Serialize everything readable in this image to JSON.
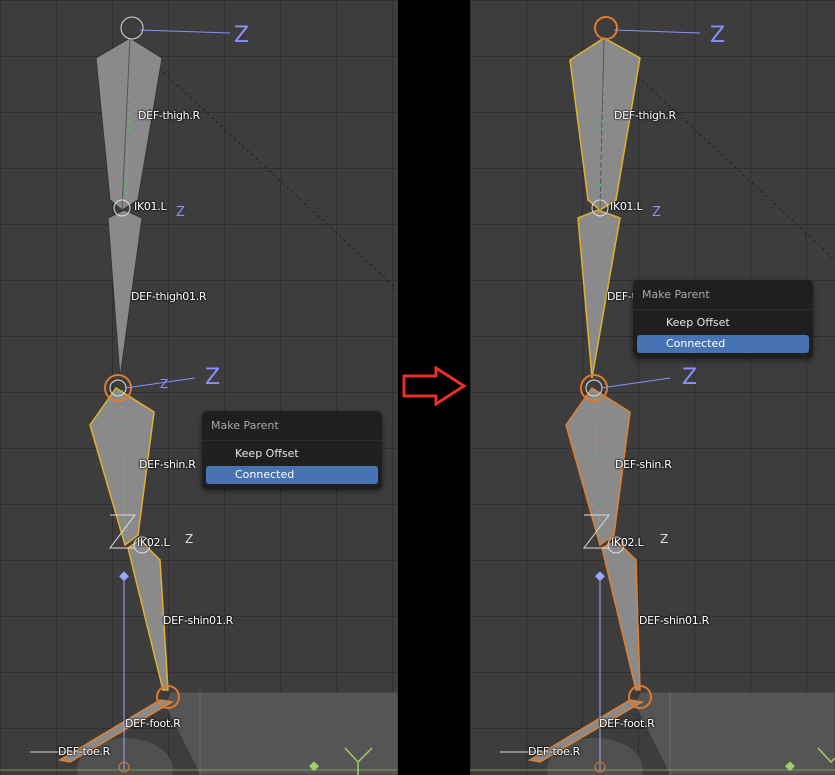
{
  "arrow_color": "#e8302b",
  "accent_color": "#4772b3",
  "axis_label": "Z",
  "left": {
    "bones": [
      "DEF-thigh.R",
      "IK01.L",
      "DEF-thigh01.R",
      "DEF-shin.R",
      "IK02.L",
      "DEF-shin01.R",
      "DEF-foot.R",
      "DEF-toe.R"
    ],
    "menu": {
      "title": "Make Parent",
      "keep_offset": "Keep Offset",
      "connected": "Connected"
    }
  },
  "right": {
    "bones": [
      "DEF-thigh.R",
      "IK01.L",
      "DEF-thigh01.R",
      "DEF-shin.R",
      "IK02.L",
      "DEF-shin01.R",
      "DEF-foot.R",
      "DEF-toe.R"
    ],
    "menu": {
      "title": "Make Parent",
      "keep_offset": "Keep Offset",
      "connected": "Connected"
    }
  }
}
